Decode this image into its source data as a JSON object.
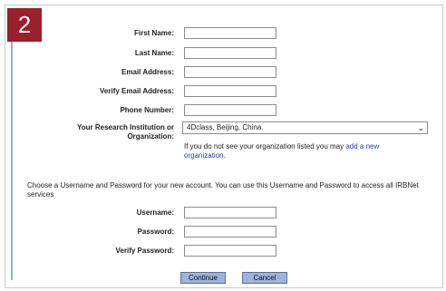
{
  "step": {
    "number": "2"
  },
  "labels": {
    "first_name": "First Name:",
    "last_name": "Last Name:",
    "email": "Email Address:",
    "verify_email": "Verify Email Address:",
    "phone": "Phone Number:",
    "institution": "Your Research Institution or Organization:",
    "username": "Username:",
    "password": "Password:",
    "verify_password": "Verify Password:"
  },
  "fields": {
    "first_name": "",
    "last_name": "",
    "email": "",
    "verify_email": "",
    "phone": "",
    "username": "",
    "password": "",
    "verify_password": ""
  },
  "institution_select": {
    "selected": "4Dclass, Beijing, China."
  },
  "org_note": {
    "text": "If you do not see your organization listed you may ",
    "link": "add a new organization",
    "end": "."
  },
  "account_intro": "Choose a Username and Password for your new account. You can use this Username and Password to access all IRBNet services",
  "buttons": {
    "continue": "Continue",
    "cancel": "Cancel"
  },
  "colors": {
    "badge": "#9b1f2c",
    "step_line": "#9aaed6",
    "button_bg": "#9fb3da",
    "link": "#2342a8"
  }
}
